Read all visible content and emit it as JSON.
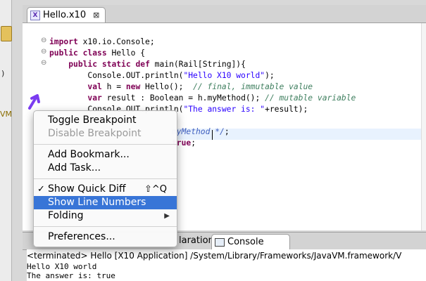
{
  "editor_tab": {
    "icon": "x10-file-icon",
    "title": "Hello.x10",
    "close_glyph": "⊠"
  },
  "code": {
    "line1": [
      "import",
      " x10.io.Console;"
    ],
    "line2": [
      "public",
      " ",
      "class",
      " Hello {"
    ],
    "line3": [
      "    ",
      "public",
      " ",
      "static",
      " ",
      "def",
      " main(Rail[String]){"
    ],
    "line4": [
      "        Console.OUT.println(",
      "\"Hello X10 world\"",
      ");"
    ],
    "line5": [
      "        ",
      "val",
      " h = ",
      "new",
      " Hello();  ",
      "// final, immutable value"
    ],
    "line6": [
      "        ",
      "var",
      " result : Boolean = h.myMethod(); ",
      "// mutable variable"
    ],
    "line7": [
      "        Console.OUT.println(",
      "\"The answer is: \"",
      "+result);"
    ],
    "line9_visible": [
      "myMethod */",
      ";"
    ],
    "line10_visible": [
      "true",
      ";"
    ],
    "fold_markers": [
      "⊖",
      "⊖",
      "⊖"
    ]
  },
  "context_menu": {
    "toggle_breakpoint": "Toggle Breakpoint",
    "disable_breakpoint": "Disable Breakpoint",
    "add_bookmark": "Add Bookmark...",
    "add_task": "Add Task...",
    "show_quick_diff": "Show Quick Diff",
    "show_quick_diff_check": "✓",
    "show_quick_diff_shortcut": "⇧^Q",
    "show_line_numbers": "Show Line Numbers",
    "folding": "Folding",
    "folding_arrow": "▶",
    "preferences": "Preferences..."
  },
  "bottom_panel": {
    "declaration_tab_partial": "laration",
    "console_tab": "Console",
    "console_header": "<terminated> Hello [X10 Application] /System/Library/Frameworks/JavaVM.framework/V",
    "output_line1": "Hello X10 world",
    "output_line2": "The answer is: true"
  },
  "left_strip": {
    "paren": ")",
    "vm_fragment": "VM"
  },
  "colors": {
    "keyword": "#7f0055",
    "string": "#2a00ff",
    "comment": "#3f7f5f",
    "javadoc": "#3f5fbf",
    "selection": "#3875d7",
    "annotation_arrow": "#7b3cf0"
  }
}
